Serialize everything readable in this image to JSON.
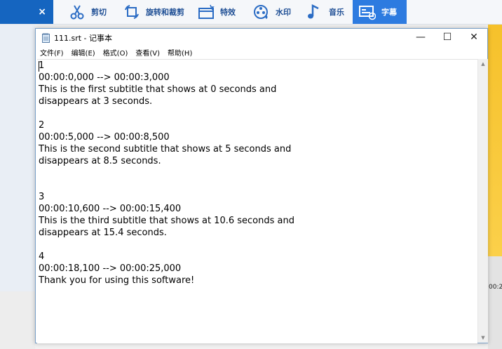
{
  "app": {
    "close_glyph": "×",
    "tools": [
      {
        "label": "剪切",
        "icon": "cut-icon"
      },
      {
        "label": "旋转和裁剪",
        "icon": "rotate-crop-icon"
      },
      {
        "label": "特效",
        "icon": "effects-icon"
      },
      {
        "label": "水印",
        "icon": "watermark-icon"
      },
      {
        "label": "音乐",
        "icon": "music-icon"
      },
      {
        "label": "字幕",
        "icon": "subtitle-icon",
        "active": true
      }
    ],
    "time_fragment": "00:2"
  },
  "notepad": {
    "title": "111.srt - 记事本",
    "buttons": {
      "minimize": "—",
      "maximize": "☐",
      "close": "✕"
    },
    "menu": [
      "文件(F)",
      "编辑(E)",
      "格式(O)",
      "查看(V)",
      "帮助(H)"
    ],
    "lines": [
      "1",
      "00:00:0,000 --> 00:00:3,000",
      "This is the first subtitle that shows at 0 seconds and",
      "disappears at 3 seconds.",
      "",
      "2",
      "00:00:5,000 --> 00:00:8,500",
      "This is the second subtitle that shows at 5 seconds and",
      "disappears at 8.5 seconds.",
      "",
      "",
      "3",
      "00:00:10,600 --> 00:00:15,400",
      "This is the third subtitle that shows at 10.6 seconds and",
      "disappears at 15.4 seconds.",
      "",
      "4",
      "00:00:18,100 --> 00:00:25,000",
      "Thank you for using this software!"
    ],
    "scroll": {
      "up": "▲",
      "down": "▼"
    }
  },
  "colors": {
    "accent": "#2d7be0",
    "tab_blue": "#1565c0",
    "yellow": "#f6c12b"
  }
}
